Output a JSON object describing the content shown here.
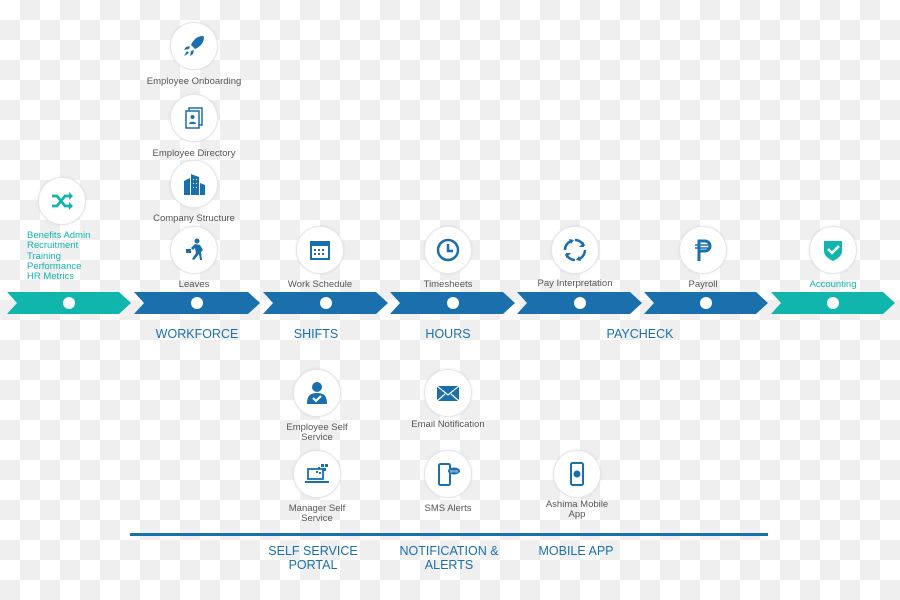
{
  "colors": {
    "teal": "#10b5ac",
    "blue": "#1a6fad",
    "text": "#555555"
  },
  "nodes": [
    {
      "id": "benefits",
      "icon": "shuffle-icon"
    },
    {
      "id": "onboarding",
      "icon": "rocket-icon",
      "label": "Employee Onboarding"
    },
    {
      "id": "directory",
      "icon": "directory-icon",
      "label": "Employee Directory"
    },
    {
      "id": "structure",
      "icon": "building-icon",
      "label": "Company Structure"
    },
    {
      "id": "leaves",
      "icon": "running-person-icon",
      "label": "Leaves"
    },
    {
      "id": "schedule",
      "icon": "calendar-icon",
      "label": "Work Schedule"
    },
    {
      "id": "timesheets",
      "icon": "clock-icon",
      "label": "Timesheets"
    },
    {
      "id": "pay",
      "icon": "refresh-cycle-icon",
      "label": "Pay Interpretation"
    },
    {
      "id": "payroll",
      "icon": "peso-icon",
      "label": "Payroll"
    },
    {
      "id": "accounting",
      "icon": "shield-check-icon",
      "label": "Accounting"
    },
    {
      "id": "ess",
      "icon": "user-check-icon",
      "label": "Employee Self\nService"
    },
    {
      "id": "email",
      "icon": "envelope-icon",
      "label": "Email Notification"
    },
    {
      "id": "mss",
      "icon": "laptop-icon",
      "label": "Manager Self\nService"
    },
    {
      "id": "sms",
      "icon": "sms-phone-icon",
      "label": "SMS Alerts"
    },
    {
      "id": "mobile",
      "icon": "mobile-chat-icon",
      "label": "Ashima Mobile\nApp"
    }
  ],
  "benefits_list": [
    "Benefits Admin",
    "Recruitment",
    "Training",
    "Performance",
    "HR Metrics"
  ],
  "sections": {
    "workforce": "WORKFORCE",
    "shifts": "SHIFTS",
    "hours": "HOURS",
    "paycheck": "PAYCHECK"
  },
  "bottom_sections": {
    "portal": "SELF SERVICE\nPORTAL",
    "alerts": "NOTIFICATION &\nALERTS",
    "mobile": "MOBILE APP"
  }
}
